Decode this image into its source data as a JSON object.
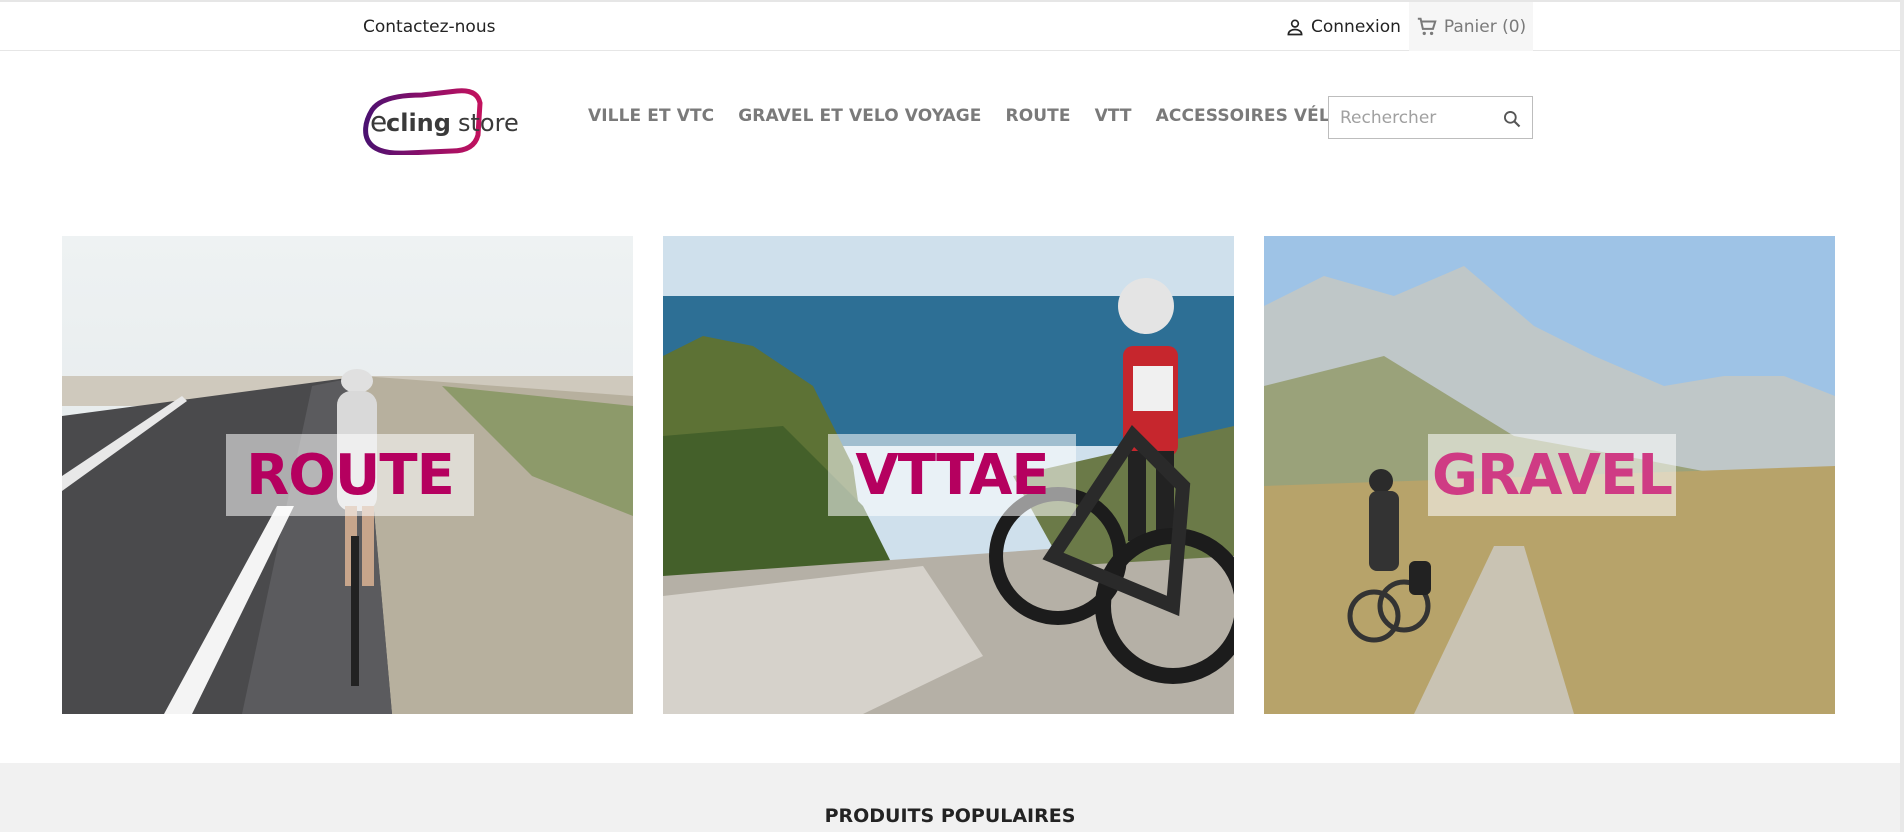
{
  "topbar": {
    "contact_label": "Contactez-nous",
    "login_label": "Connexion",
    "login_icon": "user-icon",
    "cart_label": "Panier (0)",
    "cart_icon": "cart-icon"
  },
  "header": {
    "logo_alt": "cyclingstore",
    "nav": [
      {
        "label": "VILLE ET VTC"
      },
      {
        "label": "GRAVEL ET VELO VOYAGE"
      },
      {
        "label": "ROUTE"
      },
      {
        "label": "VTT"
      },
      {
        "label": "ACCESSOIRES VÉLOS"
      }
    ],
    "search": {
      "placeholder": "Rechercher",
      "value": "",
      "icon": "search-icon"
    }
  },
  "banners": [
    {
      "label": "ROUTE"
    },
    {
      "label": "VTTAE"
    },
    {
      "label": "GRAVEL"
    }
  ],
  "popular": {
    "title": "PRODUITS POPULAIRES"
  },
  "colors": {
    "brand_magenta": "#b5005f",
    "brand_purple": "#5a1466",
    "nav_gray": "#7a7a7a"
  }
}
